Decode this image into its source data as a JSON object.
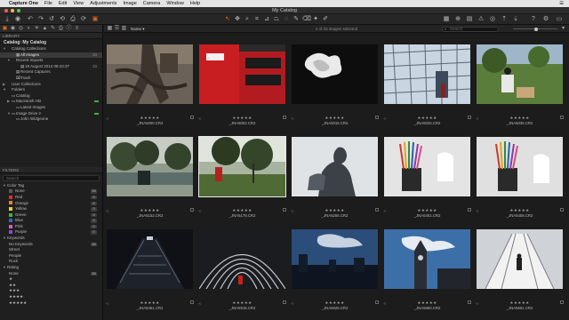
{
  "menubar": {
    "apple": "",
    "items": [
      "Capture One",
      "File",
      "Edit",
      "View",
      "Adjustments",
      "Image",
      "Camera",
      "Window",
      "Help"
    ],
    "right": [
      "☰"
    ]
  },
  "window": {
    "title": "My Catalog"
  },
  "toolbar": {
    "left_icons": [
      "import-icon",
      "capture-icon",
      "undo-icon",
      "redo-icon",
      "undo-history-icon",
      "print-icon",
      "export-icon",
      "rotate-icon",
      "process-icon"
    ],
    "center_icons": [
      "cursor-icon",
      "pan-icon",
      "zoom-icon",
      "crop-icon",
      "straighten-icon",
      "keystone-icon",
      "spot-icon",
      "brush-icon",
      "eraser-icon",
      "picker-icon",
      "color-picker-icon",
      "dropper-icon"
    ],
    "right_icons": [
      "grid-icon",
      "loupe-icon",
      "proof-icon",
      "exposure-warning-icon",
      "focus-icon",
      "copy-icon",
      "apply-icon",
      "help-icon",
      "settings-icon",
      "view-icon"
    ]
  },
  "library": {
    "header": "LIBRARY",
    "catalog_title": "Catalog: My Catalog",
    "rows": [
      {
        "label": "Catalog Collections",
        "indent": 0,
        "arrow": "▼",
        "icon": "",
        "count": "",
        "sel": false
      },
      {
        "label": "All Images",
        "indent": 2,
        "arrow": "",
        "icon": "▦",
        "count": "33",
        "sel": true
      },
      {
        "label": "Recent Imports",
        "indent": 1,
        "arrow": "▼",
        "icon": "",
        "count": "",
        "sel": false
      },
      {
        "label": "19 August 2014 08:43:37",
        "indent": 3,
        "arrow": "",
        "icon": "▤",
        "count": "33",
        "sel": false
      },
      {
        "label": "Recent Captures",
        "indent": 2,
        "arrow": "",
        "icon": "▤",
        "count": "",
        "sel": false
      },
      {
        "label": "Trash",
        "indent": 2,
        "arrow": "",
        "icon": "⌧",
        "count": "",
        "sel": false
      },
      {
        "label": "User Collections",
        "indent": 0,
        "arrow": "▶",
        "icon": "",
        "count": "",
        "sel": false
      },
      {
        "label": "Folders",
        "indent": 0,
        "arrow": "▼",
        "icon": "",
        "count": "",
        "sel": false
      },
      {
        "label": "Catalog",
        "indent": 1,
        "arrow": "",
        "icon": "▭",
        "count": "",
        "sel": false
      },
      {
        "label": "Macintosh HD",
        "indent": 1,
        "arrow": "▶",
        "icon": "▭",
        "count": "",
        "sel": false,
        "live": true
      },
      {
        "label": "Latest Images",
        "indent": 2,
        "arrow": "",
        "icon": "▭",
        "count": "",
        "sel": false
      },
      {
        "label": "Image Drive 2",
        "indent": 1,
        "arrow": "▼",
        "icon": "▭",
        "count": "",
        "sel": false,
        "live": true
      },
      {
        "label": "John Widgeone",
        "indent": 2,
        "arrow": "",
        "icon": "▭",
        "count": "",
        "sel": false
      }
    ]
  },
  "filters": {
    "header": "FILTERS",
    "search_placeholder": "Search",
    "color_tag_title": "Color Tag",
    "color_tags": [
      {
        "label": "None",
        "color": "#5a5a5a",
        "count": "33"
      },
      {
        "label": "Red",
        "color": "#d93232",
        "count": "0"
      },
      {
        "label": "Orange",
        "color": "#e4862a",
        "count": "0"
      },
      {
        "label": "Yellow",
        "color": "#e4d52a",
        "count": "0"
      },
      {
        "label": "Green",
        "color": "#3fb33f",
        "count": "0"
      },
      {
        "label": "Blue",
        "color": "#2f64d9",
        "count": "0"
      },
      {
        "label": "Pink",
        "color": "#e05cb7",
        "count": "0"
      },
      {
        "label": "Purple",
        "color": "#8a4ad9",
        "count": "0"
      }
    ],
    "keywords_title": "Keywords",
    "keywords": [
      {
        "label": "No Keywords",
        "count": "33"
      },
      {
        "label": "Street",
        "count": ""
      },
      {
        "label": "People",
        "count": ""
      },
      {
        "label": "Rock",
        "count": ""
      }
    ],
    "rating_title": "Rating",
    "ratings": [
      {
        "label": "None",
        "count": "33"
      },
      {
        "label": "★",
        "count": ""
      },
      {
        "label": "★★",
        "count": ""
      },
      {
        "label": "★★★",
        "count": ""
      },
      {
        "label": "★★★★",
        "count": ""
      },
      {
        "label": "★★★★★",
        "count": ""
      }
    ]
  },
  "browser": {
    "sort_label": "Name",
    "count_text": "1 of 33 images selected",
    "search_placeholder": "Search"
  },
  "images": [
    {
      "name": "_JNA5000.CR2",
      "stars": "★★★★★",
      "scene": "tree-roots",
      "selected": false
    },
    {
      "name": "_JNA5002.CR2",
      "stars": "★★★★★",
      "scene": "red-bus",
      "selected": false
    },
    {
      "name": "_JNA5015.CR2",
      "stars": "★★★★★",
      "scene": "flower",
      "selected": false
    },
    {
      "name": "_JNA5025.CR2",
      "stars": "★★★★★",
      "scene": "glass-building",
      "selected": false
    },
    {
      "name": "_JNA5035.CR2",
      "stars": "★★★★★",
      "scene": "park-bench",
      "selected": false
    },
    {
      "name": "_JNA5152.CR2",
      "stars": "★★★★★",
      "scene": "lake-park",
      "selected": false
    },
    {
      "name": "_JNA5178.CR2",
      "stars": "★★★★★",
      "scene": "park-trees",
      "selected": true
    },
    {
      "name": "_JNA5266.CR2",
      "stars": "★★★★★",
      "scene": "statue",
      "selected": false
    },
    {
      "name": "_JNA5401.CR2",
      "stars": "★★★★★",
      "scene": "pencils",
      "selected": false
    },
    {
      "name": "_JNA5408.CR2",
      "stars": "★★★★★",
      "scene": "pencils-2",
      "selected": false
    },
    {
      "name": "_JNA5451.CR2",
      "stars": "★★★★★",
      "scene": "tunnel",
      "selected": false
    },
    {
      "name": "_JNA5915.CR2",
      "stars": "★★★★★",
      "scene": "arch",
      "selected": false
    },
    {
      "name": "_JNA5925.CR2",
      "stars": "★★★★★",
      "scene": "skyline",
      "selected": false
    },
    {
      "name": "_JNA5650.CR2",
      "stars": "★★★★★",
      "scene": "clock-tower",
      "selected": false
    },
    {
      "name": "_JNA5661.CR2",
      "stars": "★★★★★",
      "scene": "escalator",
      "selected": false
    }
  ]
}
